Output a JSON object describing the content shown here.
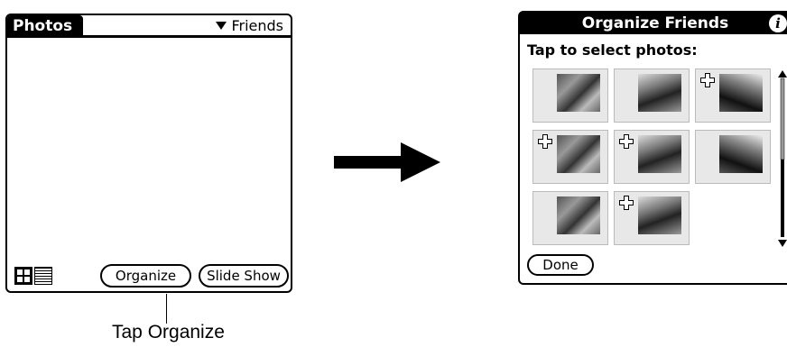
{
  "left_screen": {
    "title": "Photos",
    "category": "Friends",
    "buttons": {
      "organize": "Organize",
      "slideshow": "Slide Show"
    },
    "view_icons": [
      "thumbnail-view-icon",
      "list-view-icon"
    ]
  },
  "callout": {
    "label": "Tap Organize"
  },
  "right_screen": {
    "title": "Organize Friends",
    "instruction": "Tap to select photos:",
    "photos": [
      {
        "selected": false
      },
      {
        "selected": false
      },
      {
        "selected": true
      },
      {
        "selected": true
      },
      {
        "selected": true
      },
      {
        "selected": false
      },
      {
        "selected": false
      },
      {
        "selected": true
      }
    ],
    "done_label": "Done",
    "icons": [
      "info-icon",
      "plus-icon",
      "scroll-up-icon",
      "scroll-down-icon"
    ]
  },
  "colors": {
    "foreground": "#000000",
    "background": "#ffffff",
    "cell_background": "#e8e8e8"
  }
}
